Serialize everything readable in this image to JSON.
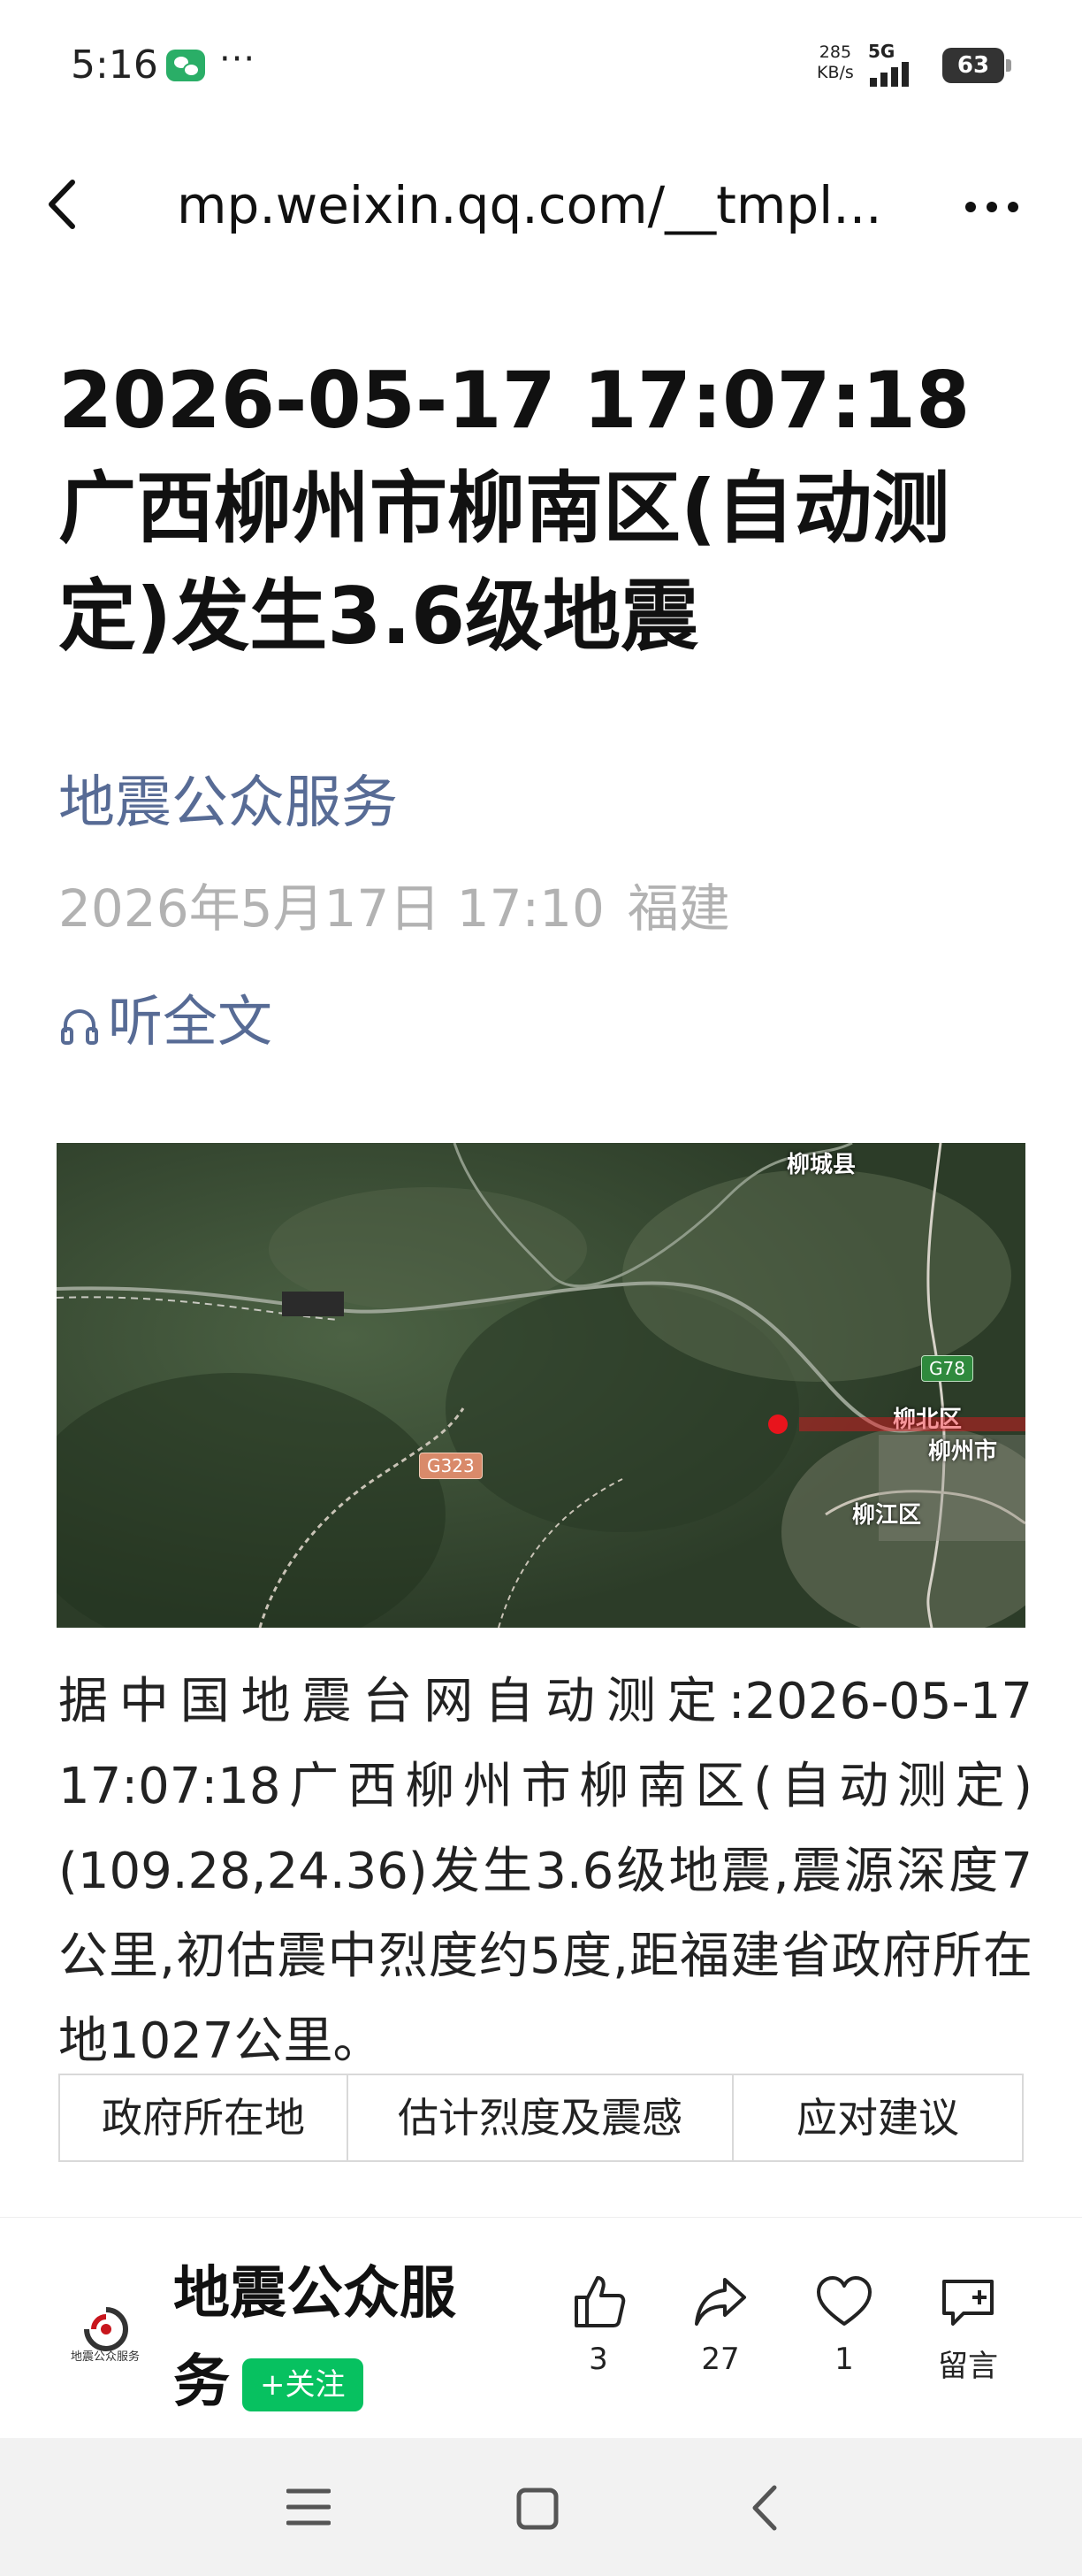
{
  "status_bar": {
    "time": "5:16",
    "notification_dots": "···",
    "net_speed_value": "285",
    "net_speed_unit": "KB/s",
    "network": "5G",
    "battery": "63"
  },
  "nav": {
    "url": "mp.weixin.qq.com/__tmpl..."
  },
  "article": {
    "title": "2026-05-17 17:07:18 广西柳州市柳南区(自动测定)发生3.6级地震",
    "account": "地震公众服务",
    "date": "2026年5月17日 17:10",
    "location": "福建",
    "listen_label": "听全文",
    "map_labels": {
      "liucheng": "柳城县",
      "liubei": "柳北区",
      "liuzhou": "柳州市",
      "liujiang": "柳江区",
      "g78": "G78",
      "g323": "G323"
    },
    "body": "据中国地震台网自动测定:2026-05-17 17:07:18广西柳州市柳南区(自动测定)(109.28,24.36)发生3.6级地震,震源深度7公里,初估震中烈度约5度,距福建省政府所在地1027公里。",
    "table_headers": [
      "政府所在地",
      "估计烈度及震感",
      "应对建议"
    ]
  },
  "bottom_bar": {
    "logo_text": "地震公众服务",
    "account_name": "地震公众服务",
    "follow_label": "+关注",
    "like_count": "3",
    "share_count": "27",
    "favorite_count": "1",
    "comment_label": "留言"
  },
  "colors": {
    "link_blue": "#576b95",
    "meta_gray": "#b2b2b2",
    "follow_green": "#07c160",
    "epicenter_red": "#e8141c"
  }
}
